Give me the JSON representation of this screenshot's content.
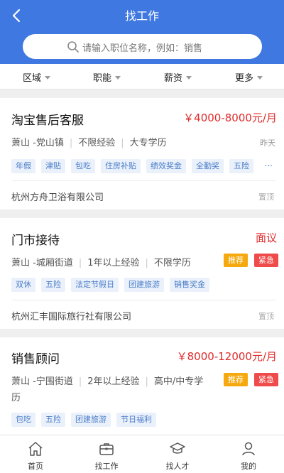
{
  "header": {
    "title": "找工作",
    "back_icon": "chevron-left-icon"
  },
  "search": {
    "placeholder": "请输入职位名称，例如：销售",
    "icon": "search-icon"
  },
  "filters": [
    {
      "label": "区域"
    },
    {
      "label": "职能"
    },
    {
      "label": "薪资"
    },
    {
      "label": "更多"
    }
  ],
  "jobs": [
    {
      "title": "淘宝售后客服",
      "salary": "￥4000-8000元/月",
      "location": "萧山 -党山镇",
      "experience": "不限经验",
      "education": "大专学历",
      "posted": "昨天",
      "tags": [
        "年假",
        "津贴",
        "包吃",
        "住房补贴",
        "绩效奖金",
        "全勤奖",
        "五险"
      ],
      "tags_more": "...",
      "company": "杭州方舟卫浴有限公司",
      "pin_label": "置顶"
    },
    {
      "title": "门市接待",
      "salary": "面议",
      "location": "萧山 -城厢街道",
      "experience": "1年以上经验",
      "education": "不限学历",
      "badges": [
        "推荐",
        "紧急"
      ],
      "tags": [
        "双休",
        "五险",
        "法定节假日",
        "团建旅游",
        "销售奖金"
      ],
      "company": "杭州汇丰国际旅行社有限公司",
      "pin_label": "置顶"
    },
    {
      "title": "销售顾问",
      "salary": "￥8000-12000元/月",
      "location": "萧山 -宁围街道",
      "experience": "2年以上经验",
      "education": "高中/中专学",
      "education_wrap": "历",
      "badges": [
        "推荐",
        "紧急"
      ],
      "tags": [
        "包吃",
        "五险",
        "团建旅游",
        "节日福利"
      ]
    }
  ],
  "tabbar": [
    {
      "label": "首页",
      "icon": "home-icon"
    },
    {
      "label": "找工作",
      "icon": "briefcase-icon",
      "active": true
    },
    {
      "label": "找人才",
      "icon": "graduation-cap-icon"
    },
    {
      "label": "我的",
      "icon": "user-icon"
    }
  ],
  "colors": {
    "primary": "#3f78e0",
    "salary": "#e02b2b",
    "tag_bg": "#eaf1fb",
    "tag_text": "#4a7cc8",
    "recommend": "#f5a90e",
    "urgent": "#f04b4b"
  }
}
